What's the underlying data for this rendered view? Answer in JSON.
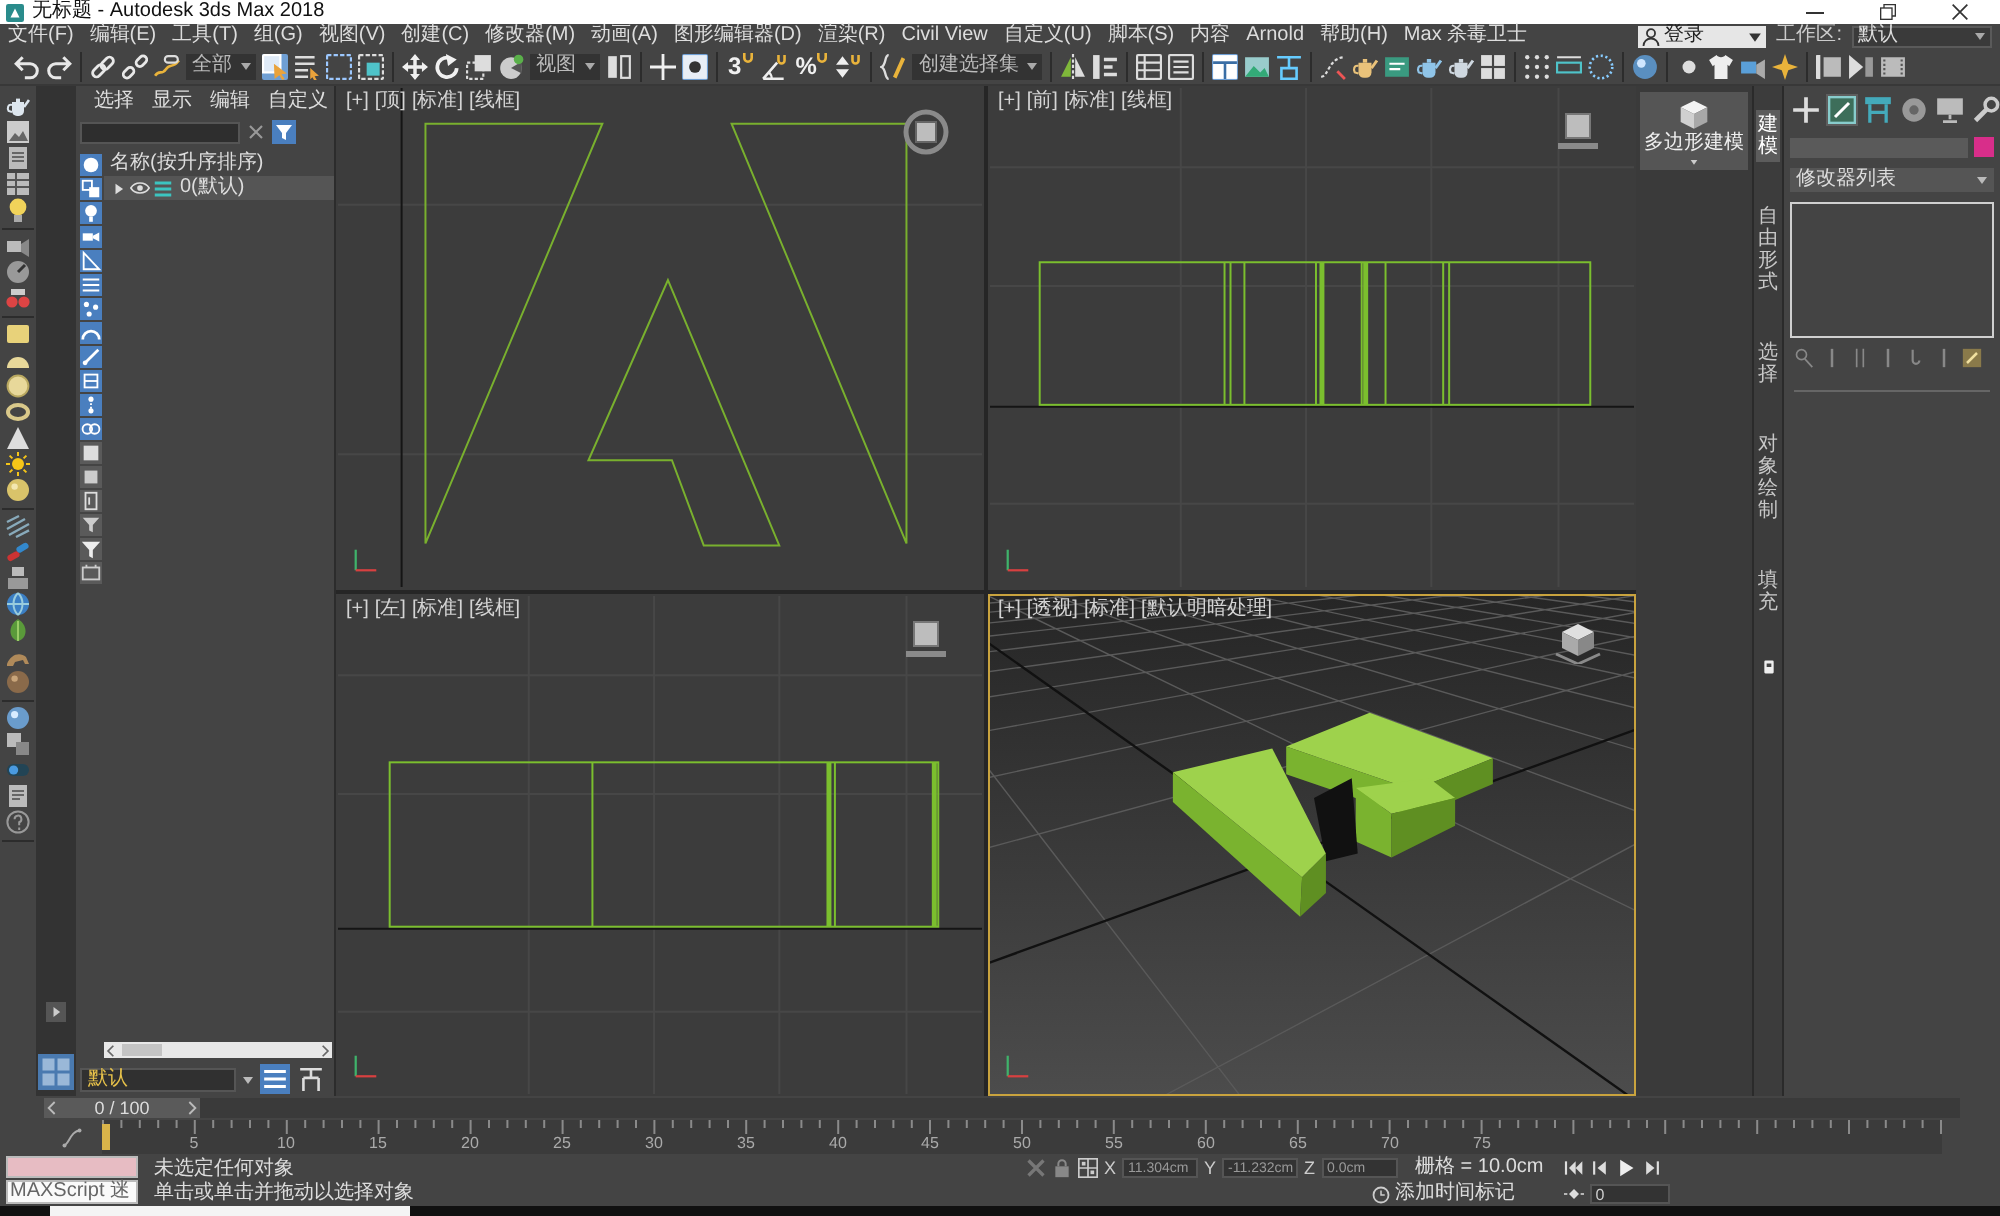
{
  "window": {
    "title": "无标题 - Autodesk 3ds Max 2018"
  },
  "menu_bar": {
    "items": [
      "文件(F)",
      "编辑(E)",
      "工具(T)",
      "组(G)",
      "视图(V)",
      "创建(C)",
      "修改器(M)",
      "动画(A)",
      "图形编辑器(D)",
      "渲染(R)",
      "Civil View",
      "自定义(U)",
      "脚本(S)",
      "内容",
      "Arnold",
      "帮助(H)",
      "Max 杀毒卫士"
    ],
    "account": "登录",
    "workspace": {
      "label": "工作区:",
      "value": "默认"
    }
  },
  "toolbar": [
    [
      {
        "kind": "icon",
        "on": false
      },
      {
        "kind": "icon",
        "on": false
      }
    ],
    [
      {
        "kind": "icon",
        "on": false
      },
      {
        "kind": "icon",
        "on": false
      },
      {
        "kind": "icon",
        "on": false
      },
      {
        "kind": "dropdown",
        "value": "全部"
      },
      {
        "kind": "icon",
        "on": true
      },
      {
        "kind": "icon",
        "on": false
      },
      {
        "kind": "icon",
        "on": false
      },
      {
        "kind": "icon",
        "on": false
      }
    ],
    [
      {
        "kind": "icon",
        "on": false
      },
      {
        "kind": "icon",
        "on": false
      },
      {
        "kind": "icon",
        "on": false
      },
      {
        "kind": "icon",
        "on": false
      },
      {
        "kind": "dropdown",
        "value": "视图"
      },
      {
        "kind": "icon",
        "on": false
      }
    ],
    [
      {
        "kind": "icon",
        "on": false
      },
      {
        "kind": "icon",
        "on": true
      }
    ],
    [
      {
        "kind": "glyph",
        "label": "3",
        "on": false
      },
      {
        "kind": "icon",
        "on": false
      },
      {
        "kind": "glyph",
        "label": "%",
        "on": false
      },
      {
        "kind": "icon",
        "on": false
      }
    ],
    [
      {
        "kind": "icon",
        "on": false
      },
      {
        "kind": "dropdown",
        "value": "创建选择集"
      }
    ],
    [
      {
        "kind": "icon",
        "on": false
      },
      {
        "kind": "icon",
        "on": false
      }
    ],
    [
      {
        "kind": "icon",
        "on": false
      },
      {
        "kind": "icon",
        "on": false
      }
    ],
    [
      {
        "kind": "icon",
        "on": true
      },
      {
        "kind": "icon",
        "on": false
      },
      {
        "kind": "icon",
        "on": false
      }
    ],
    [
      {
        "kind": "icon",
        "on": false
      },
      {
        "kind": "icon",
        "on": false
      },
      {
        "kind": "icon",
        "on": false
      },
      {
        "kind": "icon",
        "on": false
      },
      {
        "kind": "icon",
        "on": false
      },
      {
        "kind": "icon",
        "on": false
      }
    ],
    [
      {
        "kind": "icon",
        "on": false
      },
      {
        "kind": "icon",
        "on": false
      },
      {
        "kind": "icon",
        "on": false
      }
    ],
    [
      {
        "kind": "icon",
        "on": false
      }
    ],
    [
      {
        "kind": "icon",
        "on": false
      },
      {
        "kind": "icon",
        "on": false
      },
      {
        "kind": "icon",
        "on": false
      },
      {
        "kind": "icon",
        "on": false
      }
    ],
    [
      {
        "kind": "icon",
        "on": false
      },
      {
        "kind": "icon",
        "on": false
      },
      {
        "kind": "icon",
        "on": false
      }
    ]
  ],
  "scene_explorer": {
    "menu": [
      "选择",
      "显示",
      "编辑",
      "自定义"
    ],
    "filters": [
      {
        "on": true
      },
      {
        "on": true
      },
      {
        "on": true
      },
      {
        "on": true
      },
      {
        "on": true
      },
      {
        "on": true
      },
      {
        "on": true
      },
      {
        "on": true
      },
      {
        "on": true
      },
      {
        "on": true
      },
      {
        "on": true
      },
      {
        "on": true
      },
      {
        "on": false
      },
      {
        "on": false
      },
      {
        "on": false
      },
      {
        "on": false
      },
      {
        "on": false
      },
      {
        "on": false
      }
    ],
    "column_header": "名称(按升序排序)",
    "tree": [
      {
        "label": "0(默认)",
        "expanded": false,
        "selected": true
      }
    ],
    "layer": "默认",
    "layer_buttons": [
      {
        "on": true
      },
      {
        "on": false
      }
    ]
  },
  "viewports": [
    {
      "kind": "top",
      "labels": [
        "[+]",
        "[顶]",
        "[标准]",
        "[线框]"
      ],
      "active": false
    },
    {
      "kind": "front",
      "labels": [
        "[+]",
        "[前]",
        "[标准]",
        "[线框]"
      ],
      "active": false
    },
    {
      "kind": "left",
      "labels": [
        "[+]",
        "[左]",
        "[标准]",
        "[线框]"
      ],
      "active": false
    },
    {
      "kind": "perspective",
      "labels": [
        "[+]",
        "[透视]",
        "[标准]",
        "[默认明暗处理]"
      ],
      "active": true
    }
  ],
  "command_panel": {
    "ribbon_button": "多边形建模",
    "ribbon_tabs": [
      {
        "label": "建模",
        "selected": true
      },
      {
        "label": "自由形式",
        "selected": false
      },
      {
        "label": "选择",
        "selected": false
      },
      {
        "label": "对象绘制",
        "selected": false
      },
      {
        "label": "填充",
        "selected": false
      }
    ],
    "panel_tabs": [
      {
        "selected": false
      },
      {
        "selected": true
      },
      {
        "selected": false
      },
      {
        "selected": false
      },
      {
        "selected": false
      },
      {
        "selected": false
      }
    ],
    "modifier_list": "修改器列表"
  },
  "timeline": {
    "slider": {
      "label": "0 / 100",
      "level": 0
    },
    "ruler_labels": [
      "5",
      "10",
      "15",
      "20",
      "25",
      "30",
      "35",
      "40",
      "45",
      "50",
      "55",
      "60",
      "65",
      "70",
      "75"
    ]
  },
  "status_bar": {
    "maxscript": "MAXScript 迷",
    "messages": [
      "未选定任何对象",
      "单击或单击并拖动以选择对象"
    ],
    "coordinates": [
      {
        "axis": "X",
        "value": "11.304cm"
      },
      {
        "axis": "Y",
        "value": "-11.232cm"
      },
      {
        "axis": "Z",
        "value": "0.0cm"
      }
    ],
    "grid": "栅格 = 10.0cm",
    "time_tag": "添加时间标记",
    "frame": "0"
  }
}
